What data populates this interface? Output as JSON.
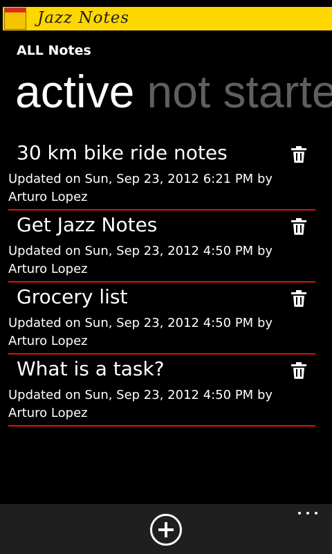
{
  "app": {
    "title": "Jazz Notes",
    "accent_color": "#FFD700",
    "divider_color": "#E01010"
  },
  "header": {
    "title": "ALL Notes"
  },
  "pivot": {
    "items": [
      "active",
      "not started"
    ],
    "selected": "active"
  },
  "notes": [
    {
      "title": "30 km bike ride notes",
      "meta": "Updated on Sun, Sep 23, 2012  6:21 PM by Arturo Lopez",
      "icon": "trash-icon"
    },
    {
      "title": "Get Jazz Notes",
      "meta": "Updated on Sun, Sep 23, 2012  4:50 PM by Arturo Lopez",
      "icon": "trash-icon"
    },
    {
      "title": "Grocery list",
      "meta": "Updated on Sun, Sep 23, 2012  4:50 PM by Arturo Lopez",
      "icon": "trash-icon"
    },
    {
      "title": "What is a task?",
      "meta": "Updated on Sun, Sep 23, 2012  4:50 PM by Arturo Lopez",
      "icon": "trash-icon"
    }
  ],
  "appbar": {
    "buttons": [
      "add-icon",
      "more-icon"
    ]
  }
}
